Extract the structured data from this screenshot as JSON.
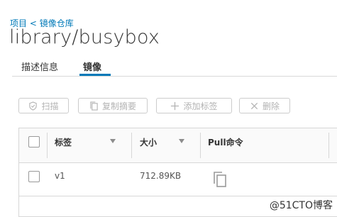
{
  "breadcrumb": {
    "projects": "项目",
    "separator": " < ",
    "repo": "镜像仓库"
  },
  "page_title": "library/busybox",
  "tabs": [
    {
      "label": "描述信息"
    },
    {
      "label": "镜像"
    }
  ],
  "toolbar": {
    "scan_label": "扫描",
    "copy_digest_label": "复制摘要",
    "add_tag_label": "添加标签",
    "delete_label": "删除"
  },
  "table": {
    "columns": [
      "标签",
      "大小",
      "Pull命令"
    ],
    "rows": [
      {
        "tag": "v1",
        "size": "712.89KB"
      }
    ]
  },
  "watermark": "@51CTO博客",
  "colors": {
    "accent": "#0079b8",
    "disabled": "#b3b3b3",
    "border": "#d7d7d7"
  }
}
